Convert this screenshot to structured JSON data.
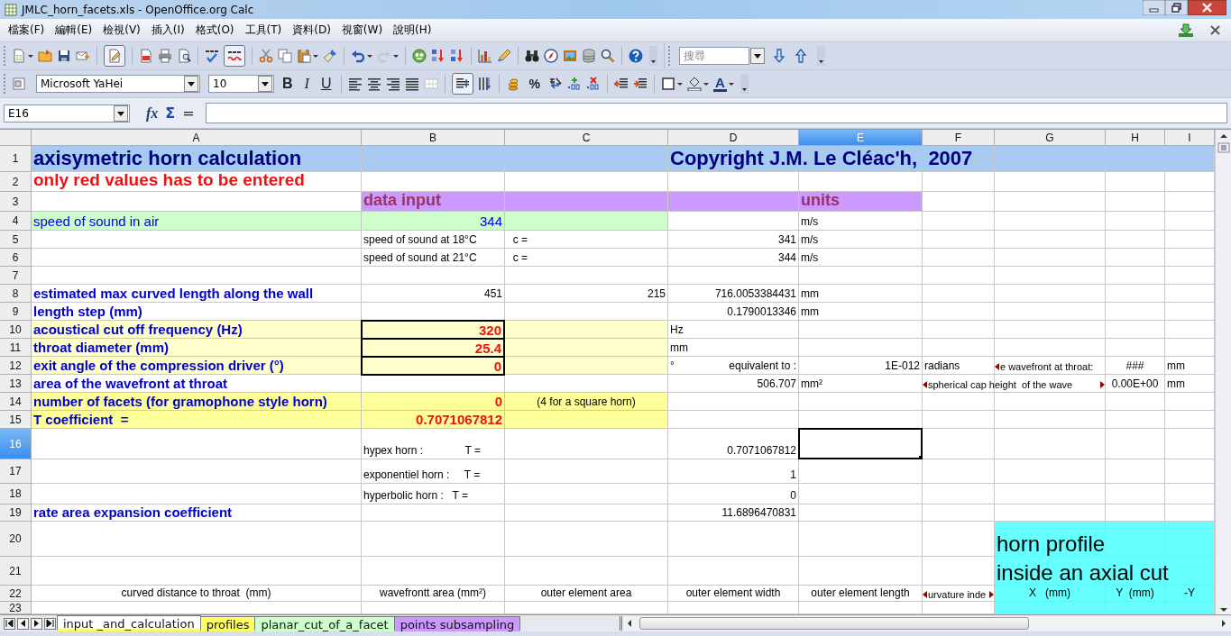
{
  "window": {
    "title": "JMLC_horn_facets.xls - OpenOffice.org Calc"
  },
  "menu": [
    "檔案(F)",
    "編輯(E)",
    "檢視(V)",
    "插入(I)",
    "格式(O)",
    "工具(T)",
    "資料(D)",
    "視窗(W)",
    "說明(H)"
  ],
  "standard_toolbar": {
    "edit_mode_on": true,
    "auto_spellcheck_on": true,
    "redo_disabled": true,
    "search_placeholder": "搜尋"
  },
  "format_toolbar": {
    "font_name": "Microsoft YaHei",
    "font_size": "10",
    "bold": "B",
    "italic": "I",
    "underline": "U",
    "percent": "%",
    "font_color": "A",
    "wrap_text_on": true
  },
  "formula_bar": {
    "cell_ref": "E16",
    "function_wizard": "fx",
    "sum": "Σ",
    "function": "="
  },
  "columns": [
    {
      "label": "A",
      "selected": false
    },
    {
      "label": "B",
      "selected": false
    },
    {
      "label": "C",
      "selected": false
    },
    {
      "label": "D",
      "selected": false
    },
    {
      "label": "E",
      "selected": true
    },
    {
      "label": "F",
      "selected": false
    },
    {
      "label": "G",
      "selected": false
    },
    {
      "label": "H",
      "selected": false
    },
    {
      "label": "I",
      "selected": false
    }
  ],
  "rows": [
    {
      "number": "1",
      "selected": false,
      "cells": {
        "A": {
          "kind": "title",
          "text": "axisymetric horn calculation",
          "color": "#a6caf0"
        },
        "B": {
          "color": "#a6caf0"
        },
        "C": {
          "color": "#a6caf0"
        },
        "D": {
          "kind": "title",
          "text": "Copyright J.M. Le Cléac'h,  2007",
          "color": "#a6caf0"
        },
        "E": {
          "color": "#a6caf0"
        },
        "F": {
          "color": "#a6caf0"
        },
        "G": {
          "color": "#a6caf0"
        },
        "H": {
          "color": "#a6caf0"
        },
        "I": {
          "color": "#a6caf0"
        }
      }
    },
    {
      "number": "2",
      "selected": false,
      "cells": {
        "A": {
          "kind": "note",
          "text": "only red values has to be entered"
        }
      }
    },
    {
      "number": "3",
      "selected": false,
      "cells": {
        "B": {
          "kind": "section",
          "text": "data input",
          "color": "#cc99ff"
        },
        "C": {
          "color": "#cc99ff"
        },
        "D": {
          "color": "#cc99ff"
        },
        "E": {
          "kind": "section",
          "text": "units",
          "color": "#cc99ff"
        }
      }
    },
    {
      "number": "4",
      "selected": false,
      "cells": {
        "A": {
          "kind": "label",
          "text": "speed of sound in air",
          "color": "#ccffcc"
        },
        "B": {
          "kind": "blue_value",
          "text": "344",
          "color": "#ccffcc"
        },
        "C": {
          "color": "#ccffcc"
        },
        "E": {
          "kind": "text",
          "text": "m/s"
        }
      }
    },
    {
      "number": "5",
      "selected": false,
      "cells": {
        "B": {
          "kind": "text",
          "text": "speed of sound at 18°C"
        },
        "C": {
          "kind": "text",
          "text": "  c ="
        },
        "D": {
          "kind": "value",
          "text": "341"
        },
        "E": {
          "kind": "text",
          "text": "m/s"
        }
      }
    },
    {
      "number": "6",
      "selected": false,
      "cells": {
        "B": {
          "kind": "text",
          "text": "speed of sound at 21°C"
        },
        "C": {
          "kind": "text",
          "text": "  c ="
        },
        "D": {
          "kind": "value",
          "text": "344"
        },
        "E": {
          "kind": "text",
          "text": "m/s"
        }
      }
    },
    {
      "number": "7",
      "selected": false
    },
    {
      "number": "8",
      "selected": false,
      "cells": {
        "A": {
          "kind": "heading",
          "text": "estimated max curved length along the wall"
        },
        "B": {
          "kind": "value",
          "text": "451"
        },
        "C": {
          "kind": "value",
          "text": "215"
        },
        "D": {
          "kind": "value",
          "text": "716.0053384431"
        },
        "E": {
          "kind": "text",
          "text": "mm"
        }
      }
    },
    {
      "number": "9",
      "selected": false,
      "cells": {
        "A": {
          "kind": "heading",
          "text": "length step (mm)"
        },
        "D": {
          "kind": "value",
          "text": "0.1790013346"
        },
        "E": {
          "kind": "text",
          "text": "mm"
        }
      }
    },
    {
      "number": "10",
      "selected": false,
      "cells": {
        "A": {
          "kind": "heading",
          "text": "acoustical cut off frequency (Hz)",
          "color": "#ffffcc"
        },
        "B": {
          "kind": "input",
          "text": "320",
          "color": "#ffffcc"
        },
        "C": {
          "color": "#ffffcc"
        },
        "D": {
          "kind": "text",
          "text": "Hz"
        }
      }
    },
    {
      "number": "11",
      "selected": false,
      "cells": {
        "A": {
          "kind": "heading",
          "text": "throat diameter (mm)",
          "color": "#ffffcc"
        },
        "B": {
          "kind": "input",
          "text": "25.4",
          "color": "#ffffcc"
        },
        "C": {
          "color": "#ffffcc"
        },
        "D": {
          "kind": "text",
          "text": "mm"
        }
      }
    },
    {
      "number": "12",
      "selected": false,
      "cells": {
        "A": {
          "kind": "heading",
          "text": "exit angle of the compression driver (°)",
          "color": "#ffffcc"
        },
        "B": {
          "kind": "input",
          "text": "0",
          "color": "#ffffcc"
        },
        "C": {
          "color": "#ffffcc"
        },
        "D": {
          "kind": "value",
          "prefix": "°",
          "text": "equivalent to :"
        },
        "E": {
          "kind": "value",
          "text": "1E-012"
        },
        "F": {
          "kind": "text",
          "text": "radians"
        },
        "G": {
          "kind": "text",
          "clipped_left": true,
          "text": "e wavefront at throat:"
        },
        "H": {
          "kind": "caption",
          "text": "###"
        },
        "I": {
          "kind": "text",
          "text": "mm"
        }
      }
    },
    {
      "number": "13",
      "selected": false,
      "cells": {
        "A": {
          "kind": "heading",
          "text": "area of the wavefront at throat"
        },
        "D": {
          "kind": "value",
          "text": "506.707"
        },
        "E": {
          "kind": "text",
          "text": "mm²"
        },
        "F": {
          "kind": "text",
          "clipped_left": true,
          "clipped_right": true,
          "text": "spherical cap height  of the wave"
        },
        "H": {
          "kind": "caption",
          "text": "0.00E+00"
        },
        "I": {
          "kind": "text",
          "text": "mm"
        }
      }
    },
    {
      "number": "14",
      "selected": false,
      "cells": {
        "A": {
          "kind": "heading",
          "text": "number of facets (for gramophone style horn)",
          "color": "#ffff99"
        },
        "B": {
          "kind": "result",
          "text": "0",
          "color": "#ffff99"
        },
        "C": {
          "kind": "caption",
          "text": "(4 for a square horn)",
          "color": "#ffff99"
        }
      }
    },
    {
      "number": "15",
      "selected": false,
      "cells": {
        "A": {
          "kind": "heading",
          "text": "T coefficient  =",
          "color": "#ffff99"
        },
        "B": {
          "kind": "result",
          "text": "0.7071067812",
          "color": "#ffff99"
        },
        "C": {
          "color": "#ffff99"
        }
      }
    },
    {
      "number": "16",
      "selected": true,
      "cells": {
        "B": {
          "kind": "text",
          "text": "hypex horn :              T ="
        },
        "D": {
          "kind": "value",
          "text": "0.7071067812"
        }
      }
    },
    {
      "number": "17",
      "selected": false,
      "cells": {
        "B": {
          "kind": "text",
          "text": "exponentiel horn :     T ="
        },
        "D": {
          "kind": "value",
          "text": "1"
        }
      }
    },
    {
      "number": "18",
      "selected": false,
      "cells": {
        "B": {
          "kind": "text",
          "text": "hyperbolic horn :   T ="
        },
        "D": {
          "kind": "value",
          "text": "0"
        }
      }
    },
    {
      "number": "19",
      "selected": false,
      "cells": {
        "A": {
          "kind": "heading",
          "text": "rate area expansion coefficient"
        },
        "D": {
          "kind": "value",
          "text": "11.6896470831"
        }
      }
    },
    {
      "number": "20",
      "selected": false,
      "cells": {
        "G": {
          "kind": "big",
          "text": "horn profile",
          "color": "#66ffff"
        },
        "H": {
          "color": "#66ffff"
        },
        "I": {
          "color": "#66ffff"
        }
      }
    },
    {
      "number": "21",
      "selected": false,
      "cells": {
        "G": {
          "kind": "big",
          "text": "inside an axial cut",
          "color": "#66ffff"
        },
        "H": {
          "color": "#66ffff"
        },
        "I": {
          "color": "#66ffff"
        }
      }
    },
    {
      "number": "22",
      "selected": false,
      "cells": {
        "A": {
          "kind": "caption",
          "text": "curved distance to throat  (mm)"
        },
        "B": {
          "kind": "caption",
          "text": "wavefrontt area (mm²)"
        },
        "C": {
          "kind": "caption",
          "text": "outer element area"
        },
        "D": {
          "kind": "caption",
          "text": "outer element width"
        },
        "E": {
          "kind": "caption",
          "text": "outer element length"
        },
        "F": {
          "kind": "text",
          "clipped_left": true,
          "clipped_right": true,
          "text": "urvature inde"
        },
        "G": {
          "kind": "caption",
          "text": "X   (mm)",
          "color": "#66ffff"
        },
        "H": {
          "kind": "caption",
          "text": "Y  (mm)",
          "color": "#66ffff"
        },
        "I": {
          "kind": "caption",
          "text": "-Y",
          "color": "#66ffff"
        }
      }
    },
    {
      "number": "23",
      "selected": false,
      "cells": {
        "G": {
          "color": "#66ffff"
        },
        "H": {
          "color": "#66ffff"
        },
        "I": {
          "color": "#66ffff"
        }
      }
    }
  ],
  "sheet_tabs": [
    {
      "label": "input _and_calculation",
      "color": "#ffff66",
      "selected": true
    },
    {
      "label": "profiles",
      "color": "#ffff66",
      "selected": false
    },
    {
      "label": "planar_cut_of_a_facet",
      "color": "#ccffcc",
      "selected": false
    },
    {
      "label": "points subsampling",
      "color": "#cc99ff",
      "selected": false
    }
  ]
}
